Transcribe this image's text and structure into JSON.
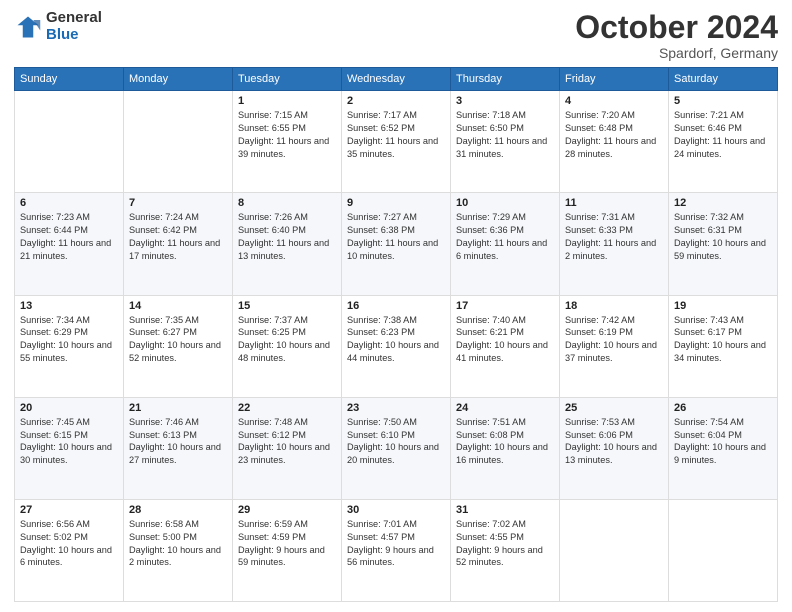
{
  "header": {
    "logo_general": "General",
    "logo_blue": "Blue",
    "month_title": "October 2024",
    "subtitle": "Spardorf, Germany"
  },
  "weekdays": [
    "Sunday",
    "Monday",
    "Tuesday",
    "Wednesday",
    "Thursday",
    "Friday",
    "Saturday"
  ],
  "weeks": [
    [
      {
        "day": "",
        "sunrise": "",
        "sunset": "",
        "daylight": ""
      },
      {
        "day": "",
        "sunrise": "",
        "sunset": "",
        "daylight": ""
      },
      {
        "day": "1",
        "sunrise": "Sunrise: 7:15 AM",
        "sunset": "Sunset: 6:55 PM",
        "daylight": "Daylight: 11 hours and 39 minutes."
      },
      {
        "day": "2",
        "sunrise": "Sunrise: 7:17 AM",
        "sunset": "Sunset: 6:52 PM",
        "daylight": "Daylight: 11 hours and 35 minutes."
      },
      {
        "day": "3",
        "sunrise": "Sunrise: 7:18 AM",
        "sunset": "Sunset: 6:50 PM",
        "daylight": "Daylight: 11 hours and 31 minutes."
      },
      {
        "day": "4",
        "sunrise": "Sunrise: 7:20 AM",
        "sunset": "Sunset: 6:48 PM",
        "daylight": "Daylight: 11 hours and 28 minutes."
      },
      {
        "day": "5",
        "sunrise": "Sunrise: 7:21 AM",
        "sunset": "Sunset: 6:46 PM",
        "daylight": "Daylight: 11 hours and 24 minutes."
      }
    ],
    [
      {
        "day": "6",
        "sunrise": "Sunrise: 7:23 AM",
        "sunset": "Sunset: 6:44 PM",
        "daylight": "Daylight: 11 hours and 21 minutes."
      },
      {
        "day": "7",
        "sunrise": "Sunrise: 7:24 AM",
        "sunset": "Sunset: 6:42 PM",
        "daylight": "Daylight: 11 hours and 17 minutes."
      },
      {
        "day": "8",
        "sunrise": "Sunrise: 7:26 AM",
        "sunset": "Sunset: 6:40 PM",
        "daylight": "Daylight: 11 hours and 13 minutes."
      },
      {
        "day": "9",
        "sunrise": "Sunrise: 7:27 AM",
        "sunset": "Sunset: 6:38 PM",
        "daylight": "Daylight: 11 hours and 10 minutes."
      },
      {
        "day": "10",
        "sunrise": "Sunrise: 7:29 AM",
        "sunset": "Sunset: 6:36 PM",
        "daylight": "Daylight: 11 hours and 6 minutes."
      },
      {
        "day": "11",
        "sunrise": "Sunrise: 7:31 AM",
        "sunset": "Sunset: 6:33 PM",
        "daylight": "Daylight: 11 hours and 2 minutes."
      },
      {
        "day": "12",
        "sunrise": "Sunrise: 7:32 AM",
        "sunset": "Sunset: 6:31 PM",
        "daylight": "Daylight: 10 hours and 59 minutes."
      }
    ],
    [
      {
        "day": "13",
        "sunrise": "Sunrise: 7:34 AM",
        "sunset": "Sunset: 6:29 PM",
        "daylight": "Daylight: 10 hours and 55 minutes."
      },
      {
        "day": "14",
        "sunrise": "Sunrise: 7:35 AM",
        "sunset": "Sunset: 6:27 PM",
        "daylight": "Daylight: 10 hours and 52 minutes."
      },
      {
        "day": "15",
        "sunrise": "Sunrise: 7:37 AM",
        "sunset": "Sunset: 6:25 PM",
        "daylight": "Daylight: 10 hours and 48 minutes."
      },
      {
        "day": "16",
        "sunrise": "Sunrise: 7:38 AM",
        "sunset": "Sunset: 6:23 PM",
        "daylight": "Daylight: 10 hours and 44 minutes."
      },
      {
        "day": "17",
        "sunrise": "Sunrise: 7:40 AM",
        "sunset": "Sunset: 6:21 PM",
        "daylight": "Daylight: 10 hours and 41 minutes."
      },
      {
        "day": "18",
        "sunrise": "Sunrise: 7:42 AM",
        "sunset": "Sunset: 6:19 PM",
        "daylight": "Daylight: 10 hours and 37 minutes."
      },
      {
        "day": "19",
        "sunrise": "Sunrise: 7:43 AM",
        "sunset": "Sunset: 6:17 PM",
        "daylight": "Daylight: 10 hours and 34 minutes."
      }
    ],
    [
      {
        "day": "20",
        "sunrise": "Sunrise: 7:45 AM",
        "sunset": "Sunset: 6:15 PM",
        "daylight": "Daylight: 10 hours and 30 minutes."
      },
      {
        "day": "21",
        "sunrise": "Sunrise: 7:46 AM",
        "sunset": "Sunset: 6:13 PM",
        "daylight": "Daylight: 10 hours and 27 minutes."
      },
      {
        "day": "22",
        "sunrise": "Sunrise: 7:48 AM",
        "sunset": "Sunset: 6:12 PM",
        "daylight": "Daylight: 10 hours and 23 minutes."
      },
      {
        "day": "23",
        "sunrise": "Sunrise: 7:50 AM",
        "sunset": "Sunset: 6:10 PM",
        "daylight": "Daylight: 10 hours and 20 minutes."
      },
      {
        "day": "24",
        "sunrise": "Sunrise: 7:51 AM",
        "sunset": "Sunset: 6:08 PM",
        "daylight": "Daylight: 10 hours and 16 minutes."
      },
      {
        "day": "25",
        "sunrise": "Sunrise: 7:53 AM",
        "sunset": "Sunset: 6:06 PM",
        "daylight": "Daylight: 10 hours and 13 minutes."
      },
      {
        "day": "26",
        "sunrise": "Sunrise: 7:54 AM",
        "sunset": "Sunset: 6:04 PM",
        "daylight": "Daylight: 10 hours and 9 minutes."
      }
    ],
    [
      {
        "day": "27",
        "sunrise": "Sunrise: 6:56 AM",
        "sunset": "Sunset: 5:02 PM",
        "daylight": "Daylight: 10 hours and 6 minutes."
      },
      {
        "day": "28",
        "sunrise": "Sunrise: 6:58 AM",
        "sunset": "Sunset: 5:00 PM",
        "daylight": "Daylight: 10 hours and 2 minutes."
      },
      {
        "day": "29",
        "sunrise": "Sunrise: 6:59 AM",
        "sunset": "Sunset: 4:59 PM",
        "daylight": "Daylight: 9 hours and 59 minutes."
      },
      {
        "day": "30",
        "sunrise": "Sunrise: 7:01 AM",
        "sunset": "Sunset: 4:57 PM",
        "daylight": "Daylight: 9 hours and 56 minutes."
      },
      {
        "day": "31",
        "sunrise": "Sunrise: 7:02 AM",
        "sunset": "Sunset: 4:55 PM",
        "daylight": "Daylight: 9 hours and 52 minutes."
      },
      {
        "day": "",
        "sunrise": "",
        "sunset": "",
        "daylight": ""
      },
      {
        "day": "",
        "sunrise": "",
        "sunset": "",
        "daylight": ""
      }
    ]
  ]
}
